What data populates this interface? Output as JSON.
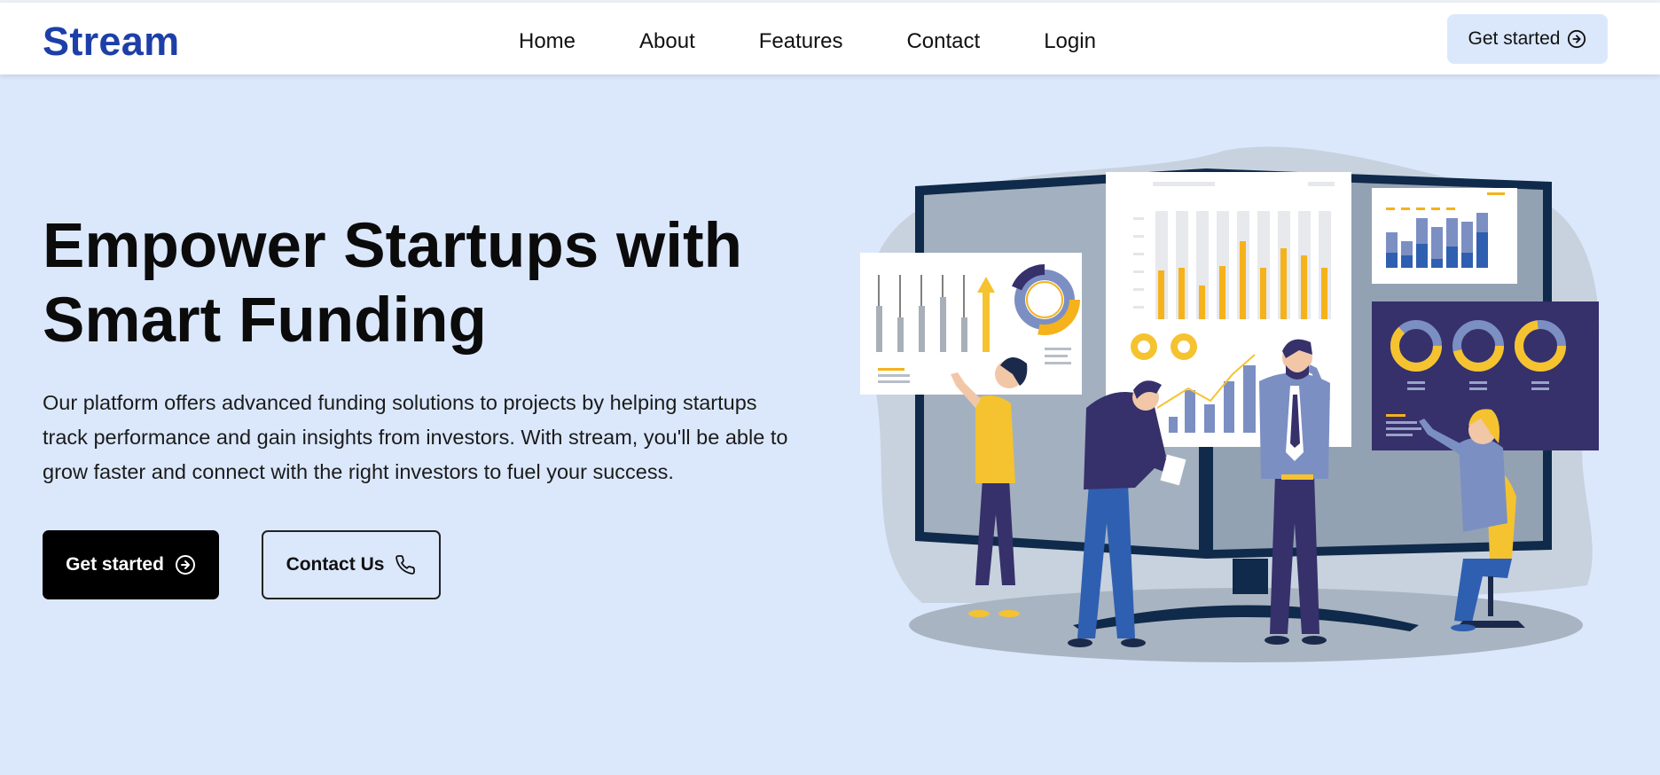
{
  "brand": {
    "name": "Stream"
  },
  "nav": {
    "links": [
      "Home",
      "About",
      "Features",
      "Contact",
      "Login"
    ],
    "cta_label": "Get started"
  },
  "hero": {
    "title_line1": "Empower Startups with",
    "title_line2": "Smart Funding",
    "description": "Our platform offers advanced funding solutions to projects by helping startups track performance and gain insights from investors. With stream, you'll be able to grow faster and connect with the right investors to fuel your success.",
    "primary_button": "Get started",
    "secondary_button": "Contact Us"
  },
  "icons": {
    "cta_arrow": "arrow-right-circle-icon",
    "phone": "phone-icon"
  },
  "colors": {
    "brand": "#1d3fa8",
    "background": "#dbe8fc",
    "accent_yellow": "#f5b21b",
    "accent_navy": "#36306b",
    "accent_blue": "#2f5fb0"
  }
}
